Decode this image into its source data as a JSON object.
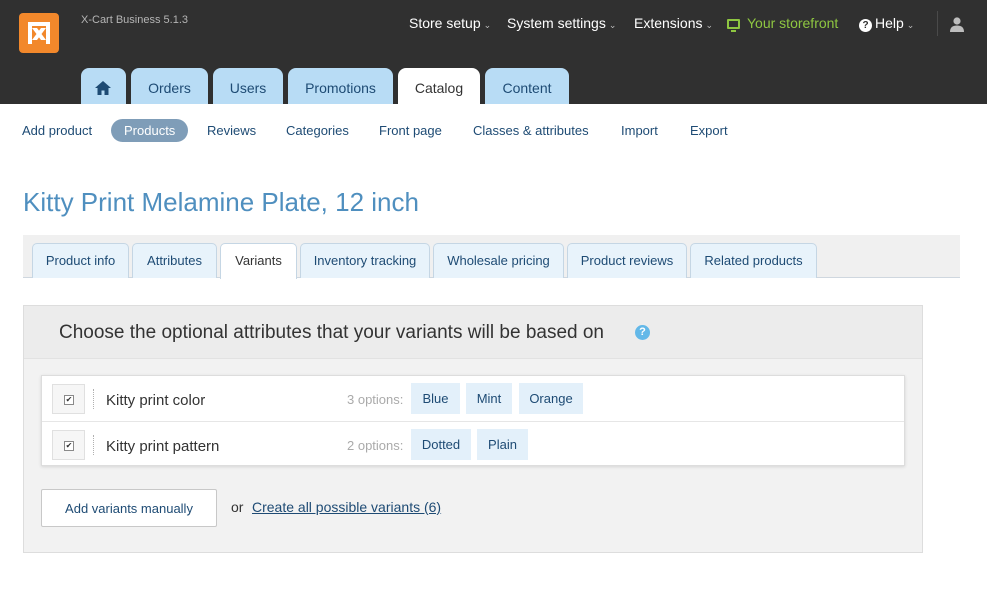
{
  "app": {
    "version": "X-Cart Business 5.1.3",
    "brand_color": "#f2882b"
  },
  "topnav": {
    "store_setup": "Store setup",
    "system_settings": "System settings",
    "extensions": "Extensions",
    "storefront": "Your storefront",
    "help": "Help",
    "storefront_color": "#8ec641"
  },
  "main_tabs": {
    "orders": "Orders",
    "users": "Users",
    "promotions": "Promotions",
    "catalog": "Catalog",
    "content": "Content"
  },
  "sub_nav": {
    "add_product": "Add product",
    "products": "Products",
    "reviews": "Reviews",
    "categories": "Categories",
    "front_page": "Front page",
    "classes": "Classes & attributes",
    "import": "Import",
    "export": "Export"
  },
  "product": {
    "title": "Kitty Print Melamine Plate, 12 inch"
  },
  "product_tabs": {
    "info": "Product info",
    "attributes": "Attributes",
    "variants": "Variants",
    "inventory": "Inventory tracking",
    "wholesale": "Wholesale pricing",
    "reviews": "Product reviews",
    "related": "Related products"
  },
  "variants": {
    "heading": "Choose the optional attributes that your variants will be based on",
    "help_glyph": "?",
    "attributes": [
      {
        "name": "Kitty print color",
        "count_label": "3 options:",
        "options": [
          "Blue",
          "Mint",
          "Orange"
        ],
        "checked": true
      },
      {
        "name": "Kitty print pattern",
        "count_label": "2 options:",
        "options": [
          "Dotted",
          "Plain"
        ],
        "checked": true
      }
    ],
    "add_manually": "Add variants manually",
    "or": "or",
    "create_all": "Create all possible variants (6)"
  }
}
